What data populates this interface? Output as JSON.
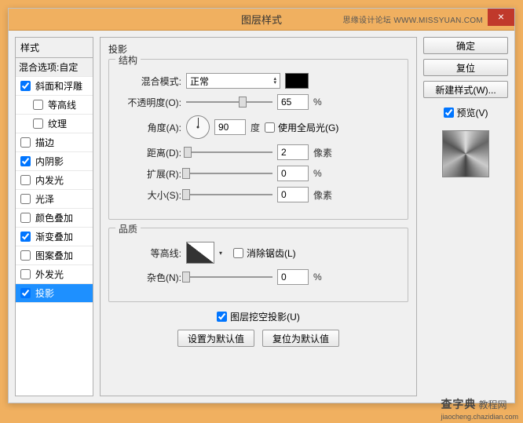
{
  "titlebar": {
    "title": "图层样式",
    "forum": "思缘设计论坛  WWW.MISSYUAN.COM",
    "close": "×"
  },
  "left": {
    "header": "样式",
    "blend": "混合选项:自定",
    "items": [
      {
        "label": "斜面和浮雕",
        "checked": true,
        "sub": false
      },
      {
        "label": "等高线",
        "checked": false,
        "sub": true
      },
      {
        "label": "纹理",
        "checked": false,
        "sub": true
      },
      {
        "label": "描边",
        "checked": false,
        "sub": false
      },
      {
        "label": "内阴影",
        "checked": true,
        "sub": false
      },
      {
        "label": "内发光",
        "checked": false,
        "sub": false
      },
      {
        "label": "光泽",
        "checked": false,
        "sub": false
      },
      {
        "label": "颜色叠加",
        "checked": false,
        "sub": false
      },
      {
        "label": "渐变叠加",
        "checked": true,
        "sub": false
      },
      {
        "label": "图案叠加",
        "checked": false,
        "sub": false
      },
      {
        "label": "外发光",
        "checked": false,
        "sub": false
      },
      {
        "label": "投影",
        "checked": true,
        "sub": false,
        "selected": true
      }
    ]
  },
  "middle": {
    "section": "投影",
    "structure": {
      "legend": "结构",
      "blend_mode_label": "混合模式:",
      "blend_mode_value": "正常",
      "opacity_label": "不透明度(O):",
      "opacity_value": "65",
      "opacity_unit": "%",
      "angle_label": "角度(A):",
      "angle_value": "90",
      "angle_unit": "度",
      "global_light": "使用全局光(G)",
      "distance_label": "距离(D):",
      "distance_value": "2",
      "distance_unit": "像素",
      "spread_label": "扩展(R):",
      "spread_value": "0",
      "spread_unit": "%",
      "size_label": "大小(S):",
      "size_value": "0",
      "size_unit": "像素"
    },
    "quality": {
      "legend": "品质",
      "contour_label": "等高线:",
      "antialias": "消除锯齿(L)",
      "noise_label": "杂色(N):",
      "noise_value": "0",
      "noise_unit": "%"
    },
    "knockout": "图层挖空投影(U)",
    "default_btn": "设置为默认值",
    "reset_btn": "复位为默认值"
  },
  "right": {
    "ok": "确定",
    "cancel": "复位",
    "new_style": "新建样式(W)...",
    "preview": "预览(V)"
  },
  "watermark": {
    "brand": "查字典",
    "site": "教程网",
    "url": "jiaocheng.chazidian.com"
  }
}
